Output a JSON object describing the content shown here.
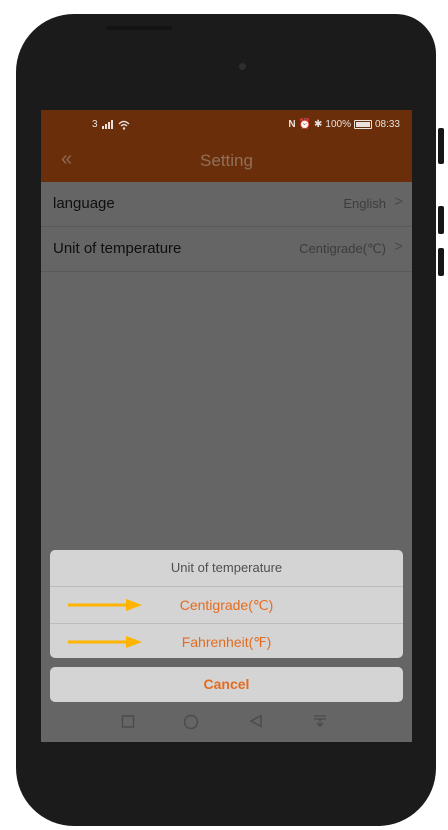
{
  "status_bar": {
    "signal_label": "3",
    "battery_percent": "100%",
    "time": "08:33",
    "icons": [
      "signal-icon",
      "wifi-icon",
      "nfc-icon",
      "alarm-icon",
      "bluetooth-icon",
      "battery-icon"
    ]
  },
  "navbar": {
    "back_icon": "double-chevron-left-icon",
    "title": "Setting"
  },
  "settings": [
    {
      "label": "language",
      "value": "English"
    },
    {
      "label": "Unit of temperature",
      "value": "Centigrade(℃)"
    }
  ],
  "action_sheet": {
    "title": "Unit of temperature",
    "options": [
      "Centigrade(℃)",
      "Fahrenheit(℉)"
    ],
    "cancel": "Cancel"
  },
  "colors": {
    "header_bg": "#6b2e0a",
    "accent_orange": "#e46b1f",
    "annotation_arrow": "#ffb400"
  },
  "system_nav": [
    "square-recents-icon",
    "circle-home-icon",
    "triangle-back-icon",
    "notification-pull-icon"
  ]
}
